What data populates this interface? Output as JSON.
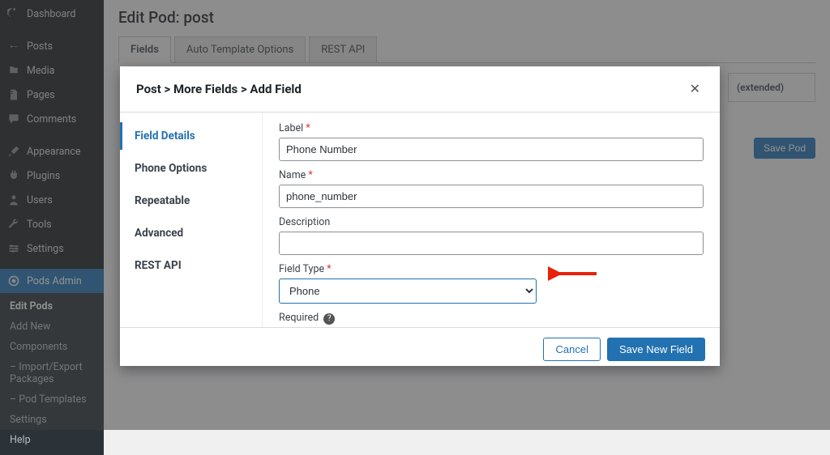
{
  "sidebar": {
    "items": [
      {
        "label": "Dashboard",
        "icon": "gauge-icon"
      },
      {
        "label": "Posts",
        "icon": "pin-icon"
      },
      {
        "label": "Media",
        "icon": "media-icon"
      },
      {
        "label": "Pages",
        "icon": "pages-icon"
      },
      {
        "label": "Comments",
        "icon": "comment-icon"
      },
      {
        "label": "Appearance",
        "icon": "brush-icon"
      },
      {
        "label": "Plugins",
        "icon": "plug-icon"
      },
      {
        "label": "Users",
        "icon": "user-icon"
      },
      {
        "label": "Tools",
        "icon": "wrench-icon"
      },
      {
        "label": "Settings",
        "icon": "sliders-icon"
      },
      {
        "label": "Pods Admin",
        "icon": "pods-icon",
        "active": true
      }
    ],
    "submenu": [
      {
        "label": "Edit Pods",
        "current": true
      },
      {
        "label": "Add New"
      },
      {
        "label": "Components"
      },
      {
        "label": "– Import/Export Packages"
      },
      {
        "label": "– Pod Templates"
      },
      {
        "label": "Settings"
      },
      {
        "label": "Help"
      }
    ]
  },
  "main": {
    "page_title": "Edit Pod:  post",
    "tabs": [
      {
        "label": "Fields",
        "active": true
      },
      {
        "label": "Auto Template Options"
      },
      {
        "label": "REST API"
      }
    ],
    "side_box_text": "(extended)",
    "save_pod_label": "Save Pod"
  },
  "modal": {
    "breadcrumb": "Post > More Fields > Add Field",
    "close_glyph": "✕",
    "sidenav": [
      {
        "label": "Field Details",
        "active": true
      },
      {
        "label": "Phone Options"
      },
      {
        "label": "Repeatable"
      },
      {
        "label": "Advanced"
      },
      {
        "label": "REST API"
      }
    ],
    "form": {
      "label_label": "Label",
      "label_value": "Phone Number",
      "name_label": "Name",
      "name_value": "phone_number",
      "description_label": "Description",
      "description_value": "",
      "field_type_label": "Field Type",
      "field_type_value": "Phone",
      "required_label": "Required",
      "required_checked": false
    },
    "footer": {
      "cancel_label": "Cancel",
      "save_label": "Save New Field"
    }
  }
}
